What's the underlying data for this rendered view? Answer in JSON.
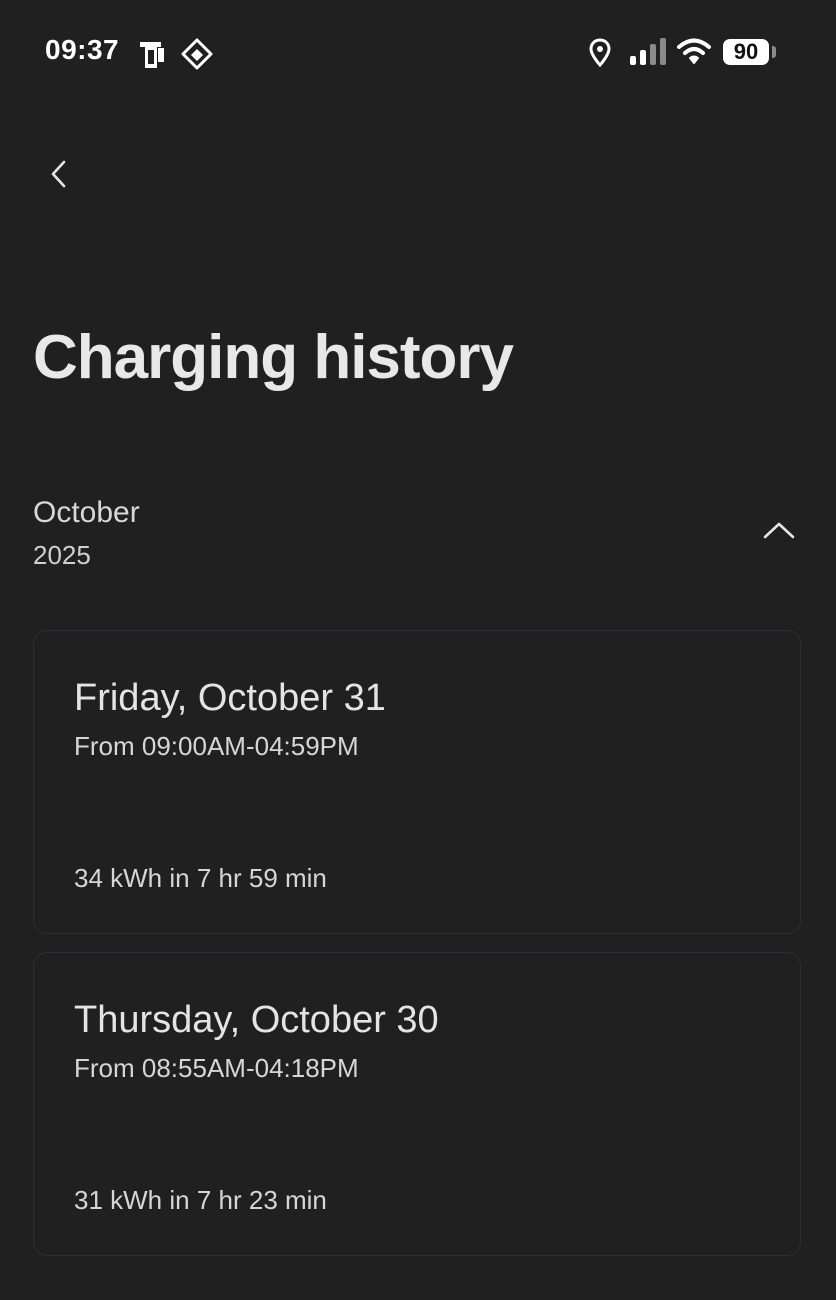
{
  "status_bar": {
    "time": "09:37",
    "battery_level": "90",
    "icons": [
      "phone-card-icon",
      "navigation-diamond-icon",
      "location-pin-icon",
      "cell-signal-icon",
      "wifi-icon",
      "battery-icon"
    ]
  },
  "header": {
    "back_icon": "chevron-left-icon",
    "title": "Charging history"
  },
  "month_group": {
    "month": "October",
    "year": "2025",
    "toggle_icon": "chevron-up-icon",
    "expanded": true
  },
  "sessions": [
    {
      "date": "Friday, October 31",
      "time_range": "From 09:00AM-04:59PM",
      "energy_summary": "34 kWh in 7 hr 59 min"
    },
    {
      "date": "Thursday, October 30",
      "time_range": "From 08:55AM-04:18PM",
      "energy_summary": "31 kWh in 7 hr 23 min"
    }
  ],
  "colors": {
    "background": "#202020",
    "text_primary": "#e4e4e4",
    "card_border": "#2c2f33"
  }
}
